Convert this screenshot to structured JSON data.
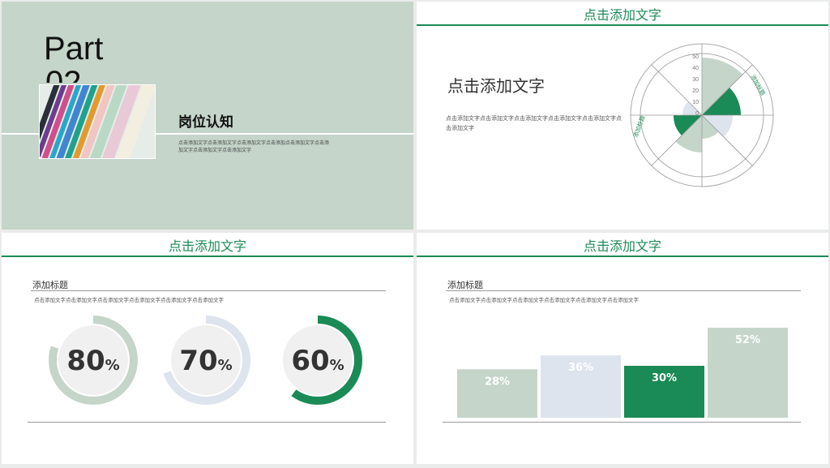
{
  "slide1": {
    "part_label": "Part",
    "part_number": "02",
    "section_title": "岗位认知",
    "section_desc": "点击添加文字点击添加文字点击添加文字点击添加点击添加文字点击添加文字点击添加文字点击添加文字"
  },
  "slide2": {
    "title": "点击添加文字",
    "heading": "点击添加文字",
    "paragraph": "点击添加文字点击添加文字点击添加文字点击添加文字点击添加文字点击添加文字",
    "radial": {
      "scale_ticks": [
        "50",
        "40",
        "30",
        "20",
        "10",
        "0"
      ],
      "ring_labels": [
        "添加标题",
        "添加标题"
      ],
      "colors": {
        "green": "#1a8a56",
        "sage": "#c5d5c9",
        "blue": "#dde4ee"
      }
    }
  },
  "slide3": {
    "title": "点击添加文字",
    "subtitle": "添加标题",
    "desc": "点击添加文字点击添加文字点击添加文字点击添加文字点击添加文字点击添加文字",
    "rings": [
      {
        "value": 80,
        "label": "80",
        "unit": "%",
        "color": "#c5d5c9"
      },
      {
        "value": 70,
        "label": "70",
        "unit": "%",
        "color": "#dde4ee"
      },
      {
        "value": 60,
        "label": "60",
        "unit": "%",
        "color": "#1a8a56"
      }
    ]
  },
  "slide4": {
    "title": "点击添加文字",
    "subtitle": "添加标题",
    "desc": "点击添加文字点击添加文字点击添加文字点击添加文字点击添加文字点击添加文字",
    "chart_data": {
      "type": "bar",
      "categories": [
        "",
        "",
        "",
        ""
      ],
      "values": [
        28,
        36,
        30,
        52
      ],
      "labels": [
        "28%",
        "36%",
        "30%",
        "52%"
      ],
      "colors": [
        "#c5d5c9",
        "#dde4ee",
        "#1a8a56",
        "#c5d5c9"
      ],
      "ylim": [
        0,
        60
      ]
    }
  }
}
